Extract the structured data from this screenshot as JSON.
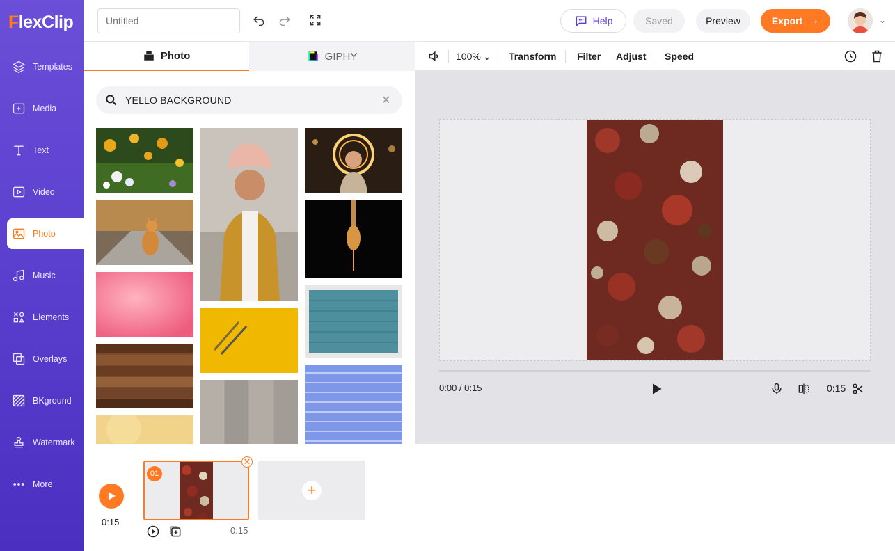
{
  "app": {
    "logo": "FlexClip"
  },
  "sidebar": {
    "items": [
      {
        "label": "Templates",
        "icon": "layers-icon"
      },
      {
        "label": "Media",
        "icon": "media-icon"
      },
      {
        "label": "Text",
        "icon": "text-icon"
      },
      {
        "label": "Video",
        "icon": "video-icon"
      },
      {
        "label": "Photo",
        "icon": "photo-icon",
        "active": true
      },
      {
        "label": "Music",
        "icon": "music-icon"
      },
      {
        "label": "Elements",
        "icon": "elements-icon"
      },
      {
        "label": "Overlays",
        "icon": "overlays-icon"
      },
      {
        "label": "BKground",
        "icon": "background-icon"
      },
      {
        "label": "Watermark",
        "icon": "stamp-icon"
      },
      {
        "label": "More",
        "icon": "more-icon"
      }
    ]
  },
  "topbar": {
    "title_placeholder": "Untitled",
    "help": "Help",
    "saved": "Saved",
    "preview": "Preview",
    "export": "Export"
  },
  "panel": {
    "tabs": [
      {
        "label": "Photo"
      },
      {
        "label": "GIPHY"
      }
    ],
    "search_value": "YELLO BACKGROUND",
    "results": [
      "flowers",
      "cat",
      "pink-clouds",
      "wood-planks",
      "yellow-texture",
      "boy-turban",
      "yellow-pencils",
      "grey-wood",
      "girl-lights",
      "honey-dipper",
      "teal-bricks",
      "blue-bricks"
    ]
  },
  "editor": {
    "zoom": "100%",
    "tools": [
      "Transform",
      "Filter",
      "Adjust",
      "Speed"
    ],
    "time_current": "0:00 / 0:15",
    "duration": "0:15"
  },
  "timeline": {
    "total": "0:15",
    "clip_number": "01",
    "clip_duration": "0:15"
  },
  "colors": {
    "accent": "#ff7a22",
    "sidebar": "#5a3fcf"
  }
}
